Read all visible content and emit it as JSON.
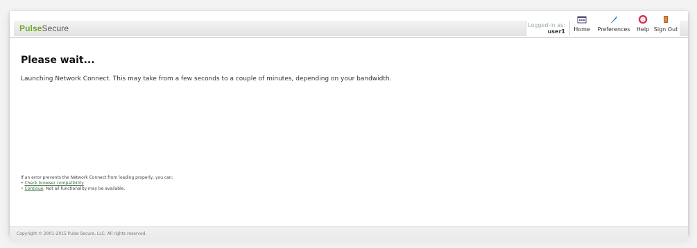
{
  "header": {
    "brand_pulse": "Pulse",
    "brand_secure": "Secure",
    "logged_in_label": "Logged-in as:",
    "username": "user1",
    "nav": [
      {
        "label": "Home",
        "icon": "home-icon"
      },
      {
        "label": "Preferences",
        "icon": "preferences-icon"
      },
      {
        "label": "Help",
        "icon": "help-icon"
      },
      {
        "label": "Sign Out",
        "icon": "sign-out-icon"
      }
    ]
  },
  "main": {
    "title": "Please wait...",
    "message": "Launching Network Connect. This may take from a few seconds to a couple of minutes, depending on your bandwidth."
  },
  "help": {
    "intro": "If an error prevents the Network Connect from loading properly, you can:",
    "link1": "Check browser compatibility",
    "link2": "Continue",
    "link2_suffix": ". Not all functionality may be available."
  },
  "footer": {
    "copyright": "Copyright © 2001-2015 Pulse Secure, LLC. All rights reserved."
  },
  "colors": {
    "brand_green": "#6fa82a",
    "link_green": "#3a6a3a",
    "help_red": "#d9334f",
    "pref_blue": "#1a5fb4"
  }
}
